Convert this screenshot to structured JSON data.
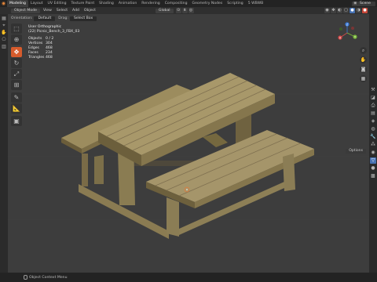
{
  "topbar": {
    "tabs": [
      "Modeling",
      "Layout",
      "UV Editing",
      "Texture Paint",
      "Shading",
      "Animation",
      "Rendering",
      "Compositing",
      "Geometry Nodes",
      "Scripting",
      "5 WBWB"
    ],
    "active_tab": 0,
    "scene_label": "Scene"
  },
  "header": {
    "mode": "Object Mode",
    "menus": [
      "View",
      "Select",
      "Add",
      "Object"
    ],
    "transform": "Global"
  },
  "subheader": {
    "orientation_label": "Orientation:",
    "orientation_value": "Default",
    "drag_label": "Drag:",
    "drag_value": "Select Box"
  },
  "stats": {
    "view": "User Orthographic",
    "object": "(22) Picnic_Bench_3_FBX_03",
    "rows": [
      {
        "k": "Objects",
        "v": "0 / 2"
      },
      {
        "k": "Vertices",
        "v": "304"
      },
      {
        "k": "Edges",
        "v": "468"
      },
      {
        "k": "Faces",
        "v": "234"
      },
      {
        "k": "Triangles",
        "v": "468"
      }
    ]
  },
  "gizmo": {
    "x": "X",
    "y": "Y",
    "z": "Z"
  },
  "options_label": "Options",
  "status": {
    "text": "Object Context Menu"
  },
  "colors": {
    "accent": "#d65b2c",
    "selected": "#4772b3",
    "viewport": "#3d3d3d"
  }
}
